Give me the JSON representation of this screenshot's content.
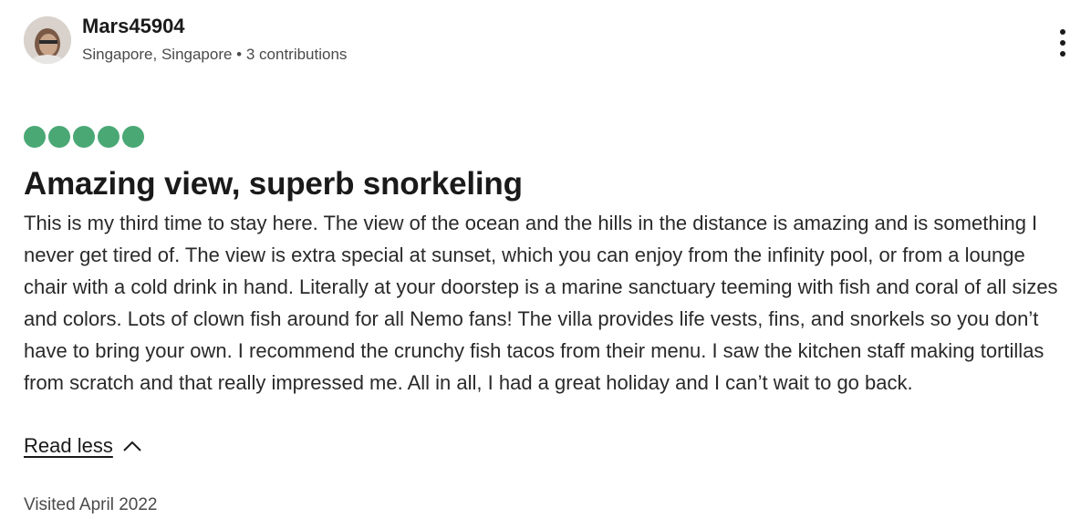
{
  "reviewer": {
    "username": "Mars45904",
    "location_contributions": "Singapore, Singapore • 3 contributions",
    "avatar_icon": "user-avatar"
  },
  "menu": {
    "icon": "more-vertical-icon"
  },
  "rating": {
    "value": 5,
    "max": 5,
    "color": "#4aa875"
  },
  "review": {
    "title": "Amazing view, superb snorkeling",
    "text": "This is my third time to stay here. The view of the ocean and the hills in the distance is amazing and is something I never get tired of. The view is extra special at sunset, which you can enjoy from the infinity pool, or from a lounge chair with a cold drink in hand. Literally at your doorstep is a marine sanctuary teeming with fish and coral of all sizes and colors. Lots of clown fish around for all Nemo fans! The villa provides life vests, fins, and snorkels so you don’t have to bring your own. I recommend the crunchy fish tacos from their menu. I saw the kitchen staff making tortillas from scratch and that really impressed me. All in all, I had a great holiday and I can’t wait to go back.",
    "read_less_label": "Read less",
    "read_less_icon": "chevron-up-icon",
    "visited": "Visited April 2022"
  }
}
